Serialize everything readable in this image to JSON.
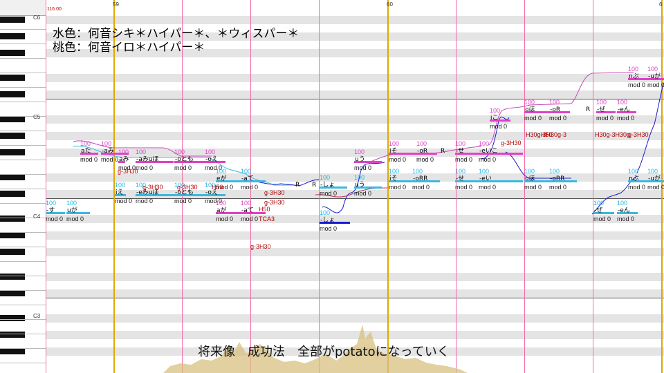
{
  "legend": {
    "line1": "水色：何音シキ＊ハイパー＊、＊ウィスパー＊",
    "line2": "桃色：何音イロ＊ハイパー＊"
  },
  "tempo": "116.00",
  "bars": [
    "59",
    "60",
    "6"
  ],
  "octaves": [
    "C6",
    "C5",
    "C4",
    "C3"
  ],
  "lyric_line": "将来像　成功法　全部がpotatoになっていく",
  "colors": {
    "cyan_voice": "#3ab8e0",
    "pink_voice": "#e040c8",
    "beat_line": "#f36aa6",
    "bar_line": "#e0a800"
  },
  "notes": [
    {
      "lyric": "-す",
      "color": "cy"
    },
    {
      "lyric": "uが",
      "color": "cy"
    },
    {
      "lyric": "aた",
      "color": "pk"
    },
    {
      "lyric": "-aみ",
      "color": "pk"
    },
    {
      "lyric": "aみ",
      "color": "pk"
    },
    {
      "lyric": "-aみuほ",
      "color": "pk"
    },
    {
      "lyric": "-oとも",
      "color": "pk"
    },
    {
      "lyric": "-oえ",
      "color": "pk"
    },
    {
      "lyric": "iえ",
      "color": "cy"
    },
    {
      "lyric": "-eみuほ",
      "color": "cy"
    },
    {
      "lyric": "-oとも",
      "color": "cy"
    },
    {
      "lyric": "-oえ",
      "color": "cy"
    },
    {
      "lyric": "eが",
      "color": "cy"
    },
    {
      "lyric": "-aて",
      "color": "cy"
    },
    {
      "lyric": "aが",
      "color": "pk"
    },
    {
      "lyric": "-aて",
      "color": "pk"
    },
    {
      "lyric": "R",
      "color": "none"
    },
    {
      "lyric": "R",
      "color": "none"
    },
    {
      "lyric": "-しょ",
      "color": "bl"
    },
    {
      "lyric": "-しょ",
      "color": "cy"
    },
    {
      "lyric": "uう",
      "color": "pk"
    },
    {
      "lyric": "uう",
      "color": "cy"
    },
    {
      "lyric": "iそ",
      "color": "pk"
    },
    {
      "lyric": "-oR",
      "color": "pk"
    },
    {
      "lyric": "R",
      "color": "none"
    },
    {
      "lyric": "iそ",
      "color": "cy"
    },
    {
      "lyric": "-oRR",
      "color": "cy"
    },
    {
      "lyric": "-せ",
      "color": "pk"
    },
    {
      "lyric": "-eいこ",
      "color": "pk"
    },
    {
      "lyric": "-せ",
      "color": "cy"
    },
    {
      "lyric": "-eい",
      "color": "cy"
    },
    {
      "lyric": "iこ",
      "color": "pk"
    },
    {
      "lyric": "oほ",
      "color": "pk"
    },
    {
      "lyric": "-oR",
      "color": "pk"
    },
    {
      "lyric": "R",
      "color": "none"
    },
    {
      "lyric": "-ぜ",
      "color": "pk"
    },
    {
      "lyric": "-eん",
      "color": "pk"
    },
    {
      "lyric": "oほ",
      "color": "cy"
    },
    {
      "lyric": "-oRR",
      "color": "cy"
    },
    {
      "lyric": "nぶ",
      "color": "pk"
    },
    {
      "lyric": "-uが",
      "color": "pk"
    },
    {
      "lyric": "nぶ",
      "color": "cy"
    },
    {
      "lyric": "-uが",
      "color": "cy"
    },
    {
      "lyric": "-ぜ",
      "color": "cy"
    },
    {
      "lyric": "-eん",
      "color": "cy"
    }
  ],
  "velocity_label": "100",
  "mod_label": "mod 0",
  "flags": [
    "g-3H30",
    "g-3H30",
    "g-3H30",
    "H50",
    "g-3H30",
    "g-3H30",
    "H30g-3H30g-3",
    "H30g-3H30g",
    "g-3H30",
    "g-3H30",
    "H50",
    "TCA3",
    "g-3H30",
    "H50"
  ]
}
